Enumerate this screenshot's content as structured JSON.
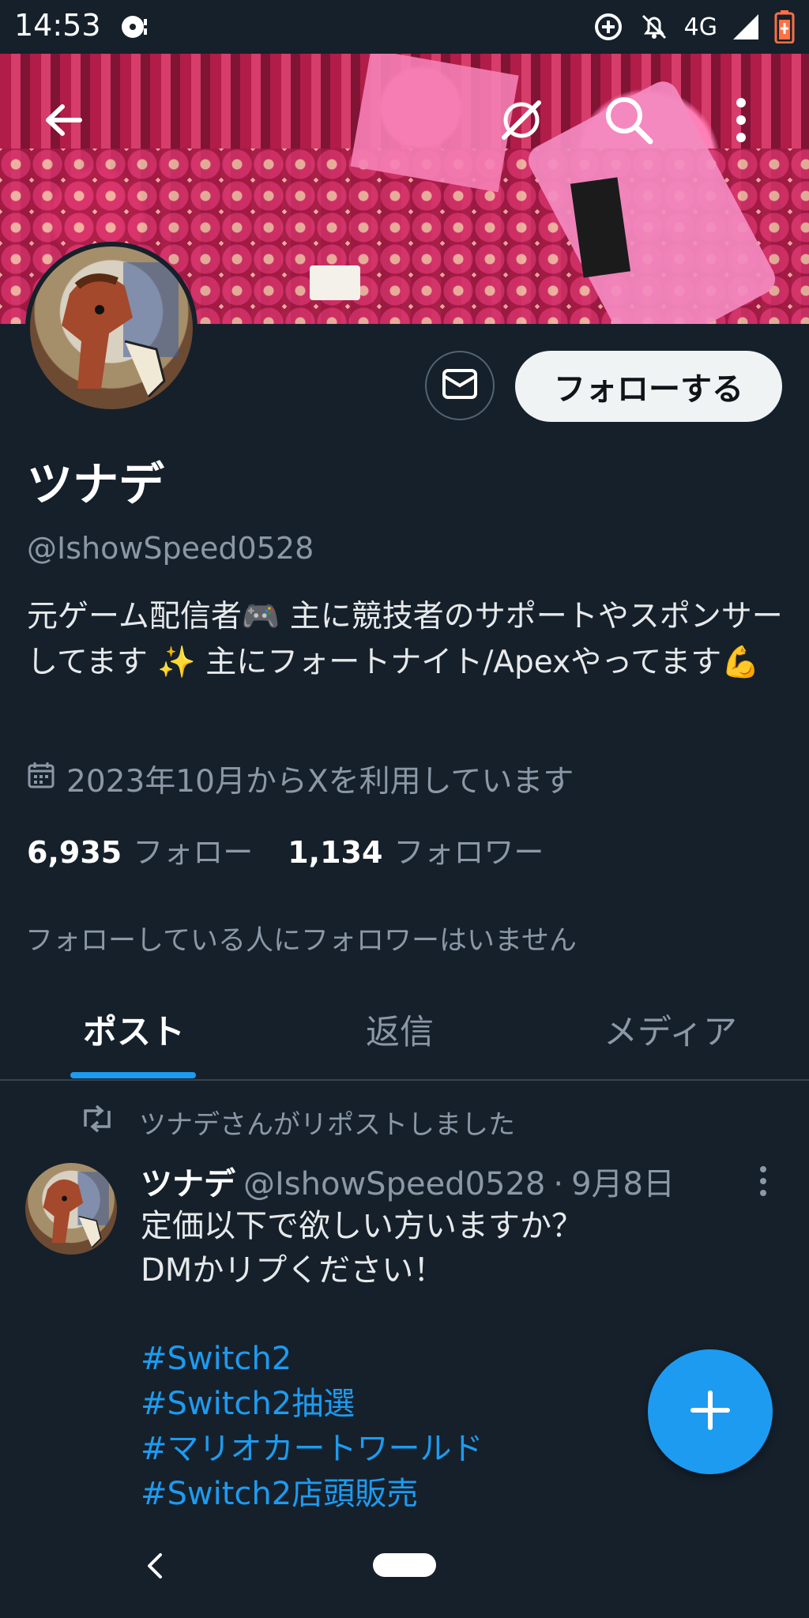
{
  "status_bar": {
    "time": "14:53",
    "network": "4G",
    "icons": [
      "media-icon",
      "data-saver-icon",
      "mute-icon",
      "signal-icon",
      "battery-icon"
    ]
  },
  "header": {
    "banner_description": "",
    "icons": [
      "back-arrow-icon",
      "no-wifi-icon",
      "search-icon",
      "more-vert-icon"
    ]
  },
  "profile": {
    "display_name": "ツナデ",
    "handle": "@IshowSpeed0528",
    "bio": "元ゲーム配信者🎮 主に競技者のサポートやスポンサーしてます ✨ 主にフォートナイト/Apexやってます💪",
    "joined": "2023年10月からXを利用しています",
    "following_count": "6,935",
    "following_label": "フォロー",
    "followers_count": "1,134",
    "followers_label": "フォロワー",
    "followers_you_know": "フォローしている人にフォロワーはいません",
    "follow_button": "フォローする"
  },
  "tabs": [
    {
      "label": "ポスト",
      "active": true
    },
    {
      "label": "返信",
      "active": false
    },
    {
      "label": "メディア",
      "active": false
    }
  ],
  "timeline": {
    "repost_label": "ツナデさんがリポストしました",
    "tweet": {
      "name": "ツナデ",
      "handle": "@IshowSpeed0528",
      "separator": "·",
      "date": "9月8日",
      "lines": [
        "定価以下で欲しい方いますか？",
        "DMかリプください！"
      ],
      "hashtags": [
        "#Switch2",
        "#Switch2抽選",
        "#マリオカートワールド",
        "#Switch2店頭販売"
      ]
    }
  },
  "colors": {
    "background": "#15202b",
    "accent": "#1d9bf0",
    "secondary_text": "#8b98a5",
    "divider": "#38444d"
  }
}
